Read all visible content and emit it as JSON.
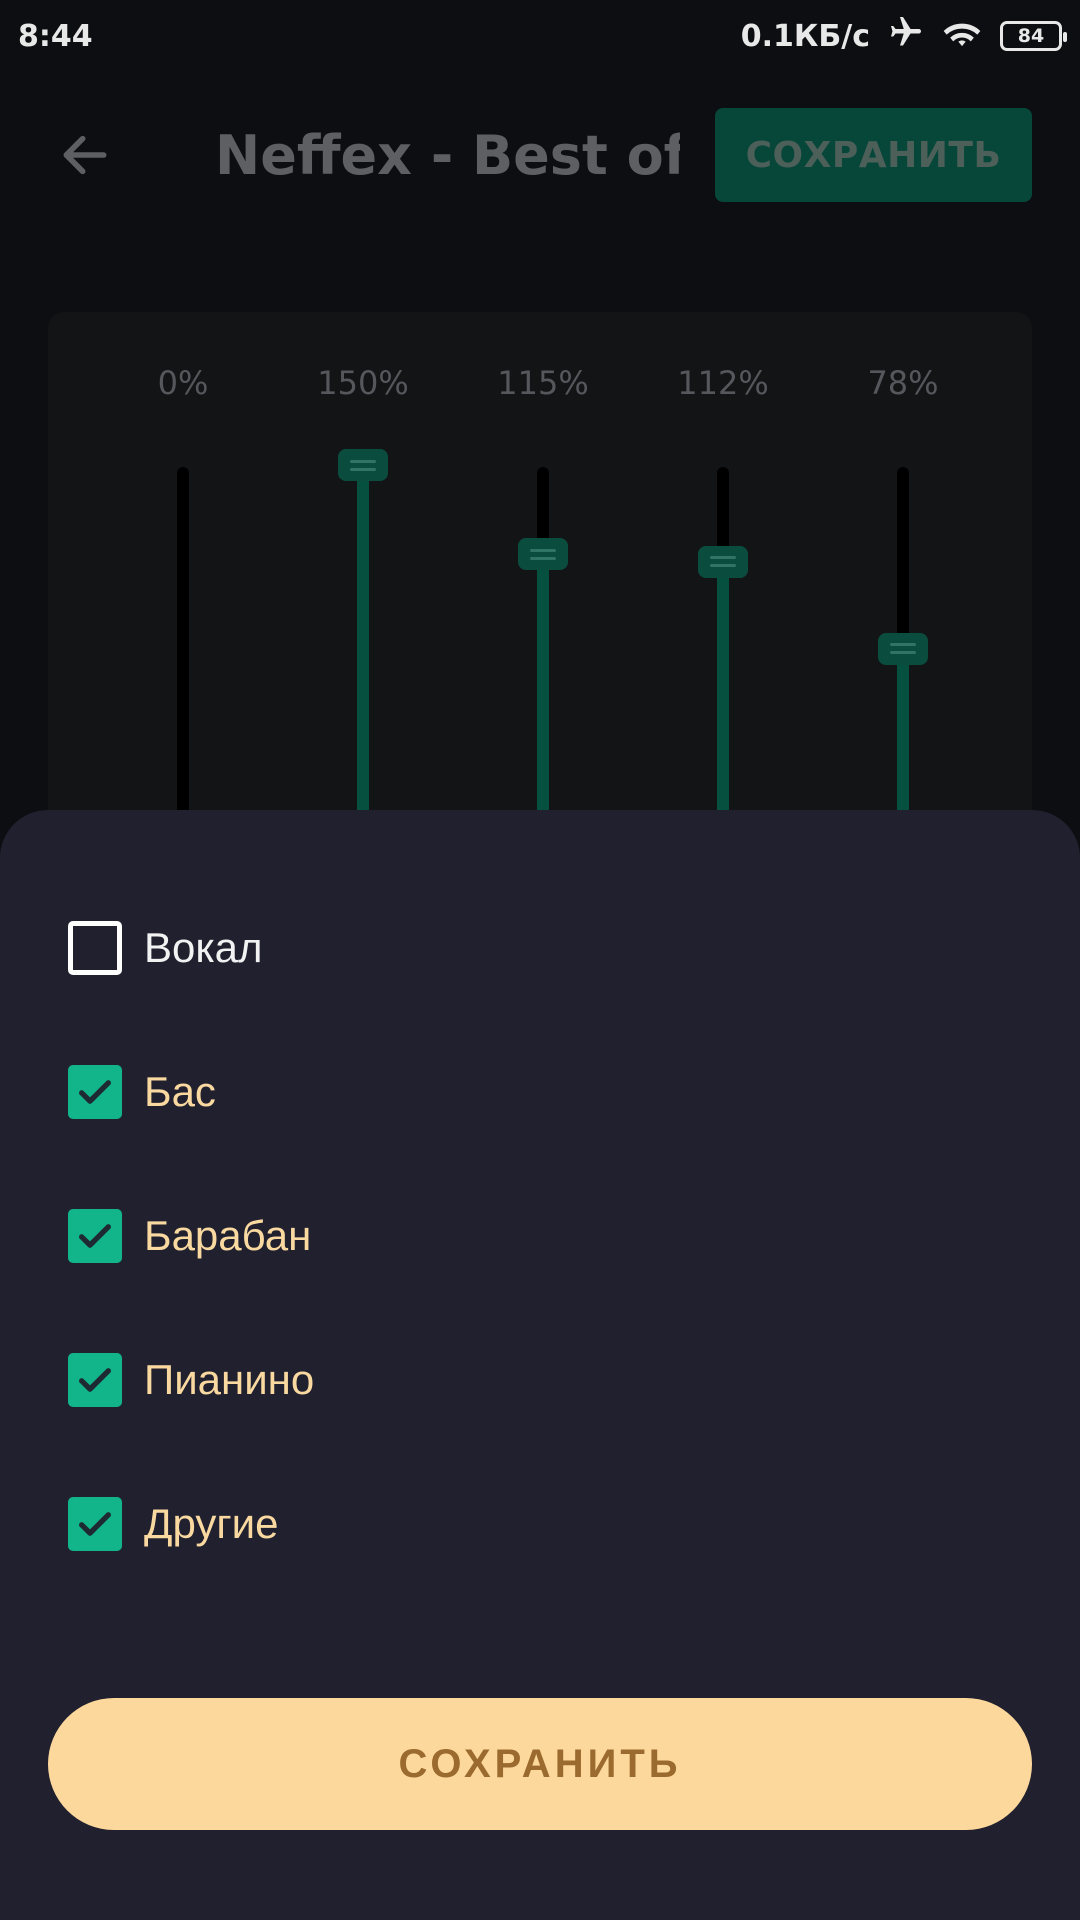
{
  "status_bar": {
    "time": "8:44",
    "network_speed": "0.1КБ/с",
    "battery": "84",
    "icons": [
      "airplane-icon",
      "wifi-icon",
      "battery-icon"
    ]
  },
  "app_bar": {
    "back_icon": "arrow-left-icon",
    "title": "Neffex - Best of…",
    "save_label": "СОХРАНИТЬ"
  },
  "mixer": {
    "channels": [
      {
        "value_label": "0%",
        "level": 0
      },
      {
        "value_label": "150%",
        "level": 150
      },
      {
        "value_label": "115%",
        "level": 115
      },
      {
        "value_label": "112%",
        "level": 112
      },
      {
        "value_label": "78%",
        "level": 78
      }
    ],
    "max_level": 150
  },
  "sheet": {
    "options": [
      {
        "label": "Вокал",
        "checked": false
      },
      {
        "label": "Бас",
        "checked": true
      },
      {
        "label": "Барабан",
        "checked": true
      },
      {
        "label": "Пианино",
        "checked": true
      },
      {
        "label": "Другие",
        "checked": true
      }
    ],
    "save_label": "СОХРАНИТЬ"
  },
  "colors": {
    "accent": "#12b58a",
    "sheet_bg": "#20202f",
    "save_button": "#fdd89c",
    "fader_fill": "#06503f"
  }
}
